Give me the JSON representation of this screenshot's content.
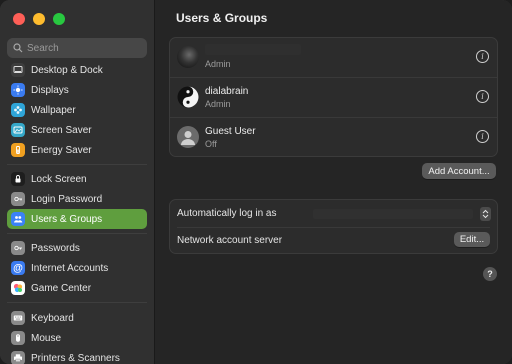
{
  "window": {
    "controls": [
      "close",
      "minimize",
      "zoom"
    ]
  },
  "search": {
    "placeholder": "Search"
  },
  "sidebar": {
    "items": [
      {
        "label": "Desktop & Dock",
        "icon": "dock-icon",
        "color": "#3d3d3d"
      },
      {
        "label": "Displays",
        "icon": "display-icon",
        "color": "#3a7bf0"
      },
      {
        "label": "Wallpaper",
        "icon": "wallpaper-icon",
        "color": "#2fa5d8"
      },
      {
        "label": "Screen Saver",
        "icon": "screensaver-icon",
        "color": "#35a8c9"
      },
      {
        "label": "Energy Saver",
        "icon": "energy-icon",
        "color": "#f0a020"
      },
      {
        "label": "Lock Screen",
        "icon": "lock-icon",
        "color": "#1e1e1e"
      },
      {
        "label": "Login Password",
        "icon": "key-icon",
        "color": "#8a8a8a"
      },
      {
        "label": "Users & Groups",
        "icon": "users-icon",
        "color": "#3b82f6",
        "selected": true
      },
      {
        "label": "Passwords",
        "icon": "password-key-icon",
        "color": "#8a8a8a"
      },
      {
        "label": "Internet Accounts",
        "icon": "at-icon",
        "color": "#3a7bf0"
      },
      {
        "label": "Game Center",
        "icon": "game-center-icon",
        "color": "#ffffff"
      },
      {
        "label": "Keyboard",
        "icon": "keyboard-icon",
        "color": "#8a8a8a"
      },
      {
        "label": "Mouse",
        "icon": "mouse-icon",
        "color": "#8a8a8a"
      },
      {
        "label": "Printers & Scanners",
        "icon": "printer-icon",
        "color": "#8a8a8a"
      }
    ]
  },
  "main": {
    "title": "Users & Groups",
    "users": [
      {
        "name": "",
        "role": "Admin",
        "avatar": "photo-avatar",
        "name_redacted": true
      },
      {
        "name": "dialabrain",
        "role": "Admin",
        "avatar": "yin-yang-avatar"
      },
      {
        "name": "Guest User",
        "role": "Off",
        "avatar": "generic-person-avatar"
      }
    ],
    "add_account_label": "Add Account...",
    "settings": {
      "auto_login_label": "Automatically log in as",
      "auto_login_value": "",
      "network_server_label": "Network account server",
      "edit_label": "Edit..."
    },
    "help_label": "?"
  },
  "colors": {
    "accent": "#5f9e3e",
    "background": "#252525",
    "sidebar": "#303030"
  }
}
